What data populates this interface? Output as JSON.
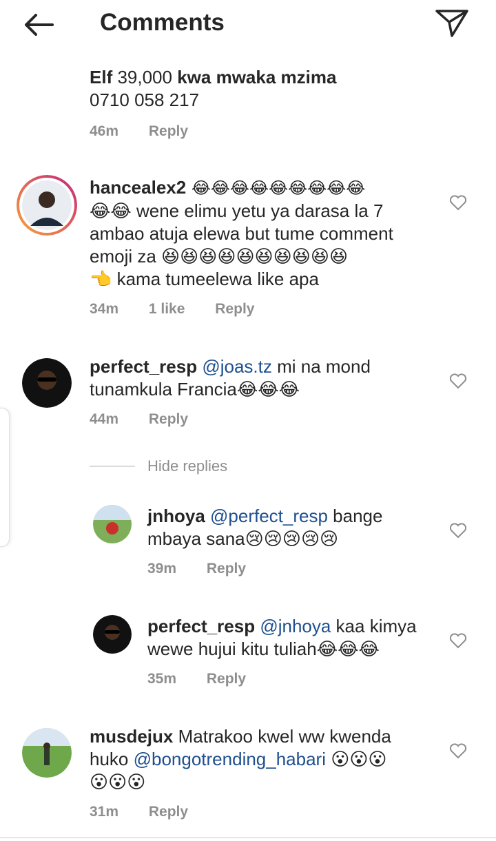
{
  "header": {
    "title": "Comments"
  },
  "icons": {
    "back": "arrow-left-icon",
    "send": "paper-plane-icon",
    "like": "heart-outline-icon"
  },
  "colors": {
    "mention": "#1e4f8f",
    "muted": "#8e8e8e",
    "story_ring_start": "#f9a13b",
    "story_ring_end": "#c5287a"
  },
  "partial_comment": {
    "line1_bold_a": "Elf",
    "line1_plain": " 39,000 ",
    "line1_bold_b": "kwa mwaka mzima",
    "line2": "0710 058 217",
    "time": "46m",
    "reply": "Reply"
  },
  "comments": [
    {
      "username": "hancealex2",
      "line1_emoji": " 😂😂😂😂😂😂😂😂😂",
      "line2": "😂😂 wene elimu yetu ya darasa la 7",
      "line3": "ambao atuja elewa but tume comment",
      "line4": "emoji za 😆😆😆😆😆😆😆😆😆😆",
      "line5": "👈 kama tumeelewa like apa",
      "time": "34m",
      "likes": "1 like",
      "reply": "Reply"
    },
    {
      "username": "perfect_resp",
      "mention": "@joas.tz",
      "line1_rest": " mi na mond",
      "line2": "tunamkula Francia😂😂😂",
      "time": "44m",
      "reply": "Reply"
    }
  ],
  "hide_replies": "Hide replies",
  "replies": [
    {
      "username": "jnhoya",
      "mention": "@perfect_resp",
      "line1_rest": " bange",
      "line2": "mbaya sana😢😢😢😢😢",
      "time": "39m",
      "reply": "Reply"
    },
    {
      "username": "perfect_resp",
      "mention": "@jnhoya",
      "line1_rest": " kaa kimya",
      "line2": "wewe hujui kitu tuliah😂😂😂",
      "time": "35m",
      "reply": "Reply"
    }
  ],
  "last_comment": {
    "username": "musdejux",
    "line1_rest": " Matrakoo kwel ww kwenda",
    "line2_prefix": "huko ",
    "mention": "@bongotrending_habari",
    "line2_emoji": " 😮😮😮",
    "line3": "😮😮😮",
    "time": "31m",
    "reply": "Reply"
  }
}
